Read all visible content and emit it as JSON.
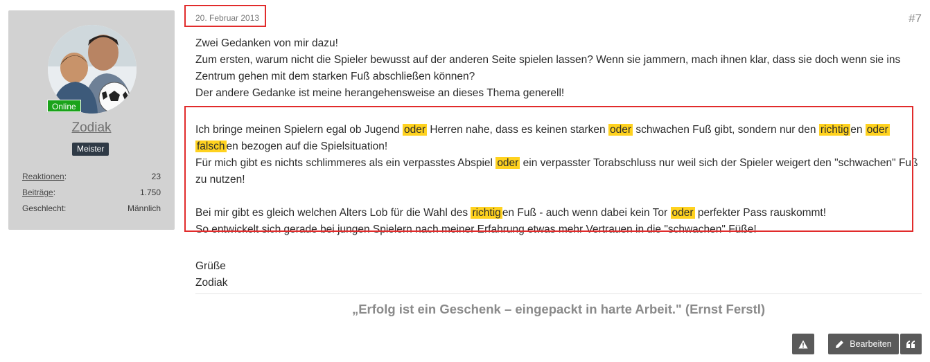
{
  "user": {
    "name": "Zodiak",
    "online_label": "Online",
    "rank": "Meister",
    "stats": [
      {
        "label": "Reaktionen",
        "value": "23",
        "link": true
      },
      {
        "label": "Beiträge",
        "value": "1.750",
        "link": true
      },
      {
        "label": "Geschlecht",
        "value": "Männlich",
        "link": false
      }
    ]
  },
  "post": {
    "date": "20. Februar 2013",
    "number": "#7",
    "intro": [
      "Zwei Gedanken von mir dazu!",
      "Zum ersten, warum nicht die Spieler bewusst auf der anderen Seite spielen lassen? Wenn sie jammern, mach ihnen klar, dass sie doch wenn sie ins Zentrum gehen mit dem starken Fuß abschließen können?",
      "Der andere Gedanke ist meine herangehensweise an dieses Thema generell!"
    ],
    "highlighted": {
      "p1": {
        "t1": "Ich bringe meinen Spielern egal ob Jugend ",
        "h1": "oder",
        "t2": " Herren nahe, dass es keinen starken ",
        "h2": "oder",
        "t3": " schwachen Fuß gibt, sondern nur den ",
        "h3": "richtig",
        "t4": "en ",
        "h4": "oder",
        "t5": " ",
        "h5": "falsch",
        "t6": "en bezogen auf die Spielsituation!"
      },
      "p2": {
        "t1": "Für mich gibt es nichts schlimmeres als ein verpasstes Abspiel ",
        "h1": "oder",
        "t2": " ein verpasster Torabschluss nur weil sich der Spieler weigert den \"schwachen\" Fuß zu nutzen!"
      },
      "p3": {
        "t1": "Bei mir gibt es gleich welchen Alters Lob für die Wahl des ",
        "h1": "richtig",
        "t2": "en Fuß - auch wenn dabei kein Tor ",
        "h2": "oder",
        "t3": " perfekter Pass rauskommt!"
      },
      "p4": "So entwickelt sich gerade bei jungen Spielern nach meiner Erfahrung etwas mehr Vertrauen in die \"schwachen\" Füße!"
    },
    "closing": [
      "Grüße",
      "Zodiak"
    ],
    "signature": "„Erfolg ist ein Geschenk – eingepackt in harte Arbeit.\" (Ernst Ferstl)"
  },
  "actions": {
    "report_icon": "warning-icon",
    "edit_label": "Bearbeiten",
    "edit_icon": "pencil-icon",
    "quote_icon": "quote-icon"
  },
  "colors": {
    "highlight": "#ffd21f",
    "annotation_box": "#e12b2b",
    "online": "#1aa31a",
    "button": "#5a5a5a",
    "rank_badge": "#2f3a46"
  }
}
